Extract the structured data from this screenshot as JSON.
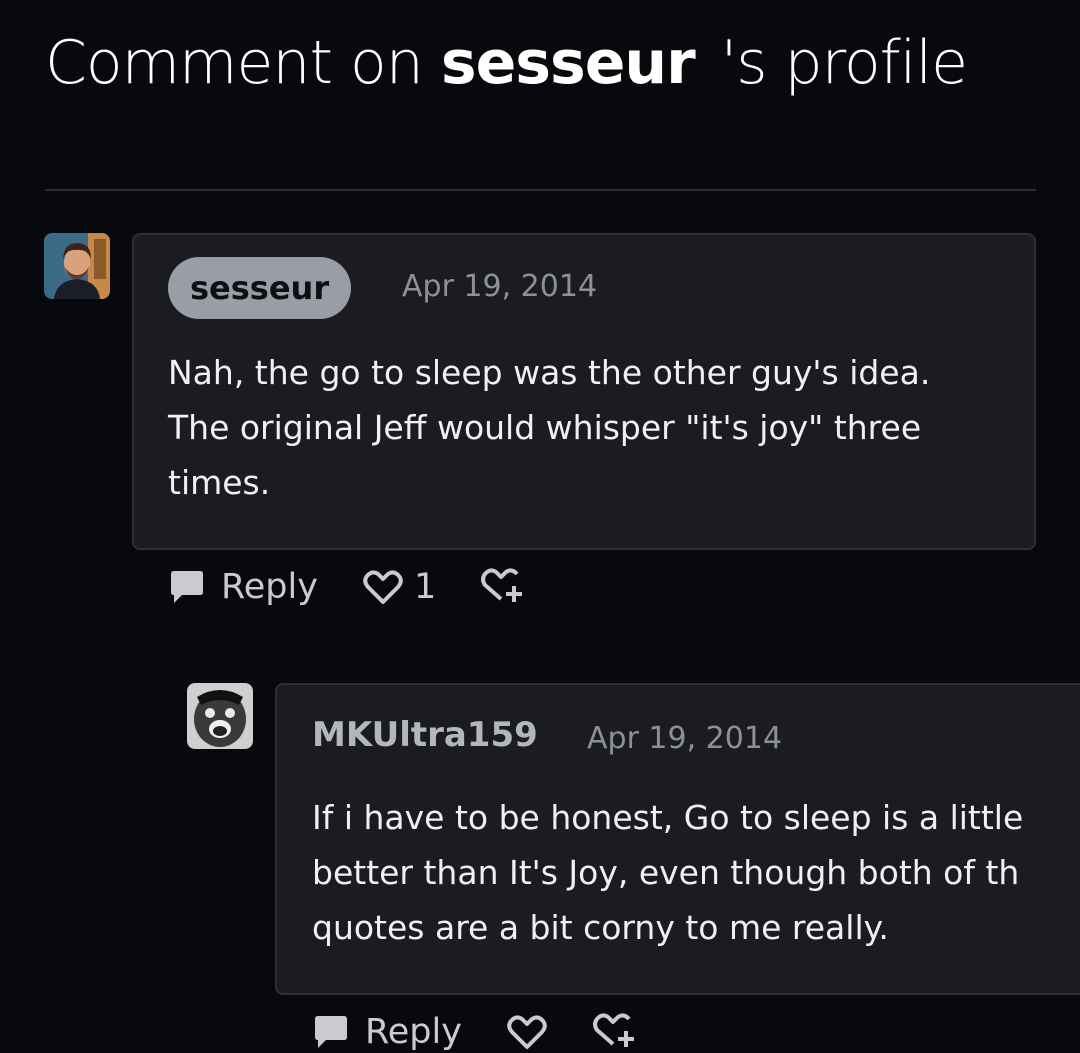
{
  "header": {
    "prefix": "Comment on",
    "username": "sesseur",
    "suffix": "'s profile"
  },
  "comments": [
    {
      "username": "sesseur",
      "date": "Apr 19, 2014",
      "text": "Nah, the go to sleep was the other guy's idea.\nThe original Jeff would whisper \"it's joy\" three\ntimes.",
      "reply_label": "Reply",
      "like_count": "1"
    },
    {
      "username": "MKUltra159",
      "date": "Apr 19, 2014",
      "text": "If i have to be honest, Go to sleep is a little\nbetter than It's Joy, even though both of th\nquotes are a bit corny to me really.",
      "reply_label": "Reply"
    }
  ],
  "colors": {
    "background": "#08090d",
    "card": "#1a1c21",
    "badge": "#9a9ca6"
  },
  "icons": [
    "comment-icon",
    "heart-icon",
    "add-reaction-icon"
  ]
}
